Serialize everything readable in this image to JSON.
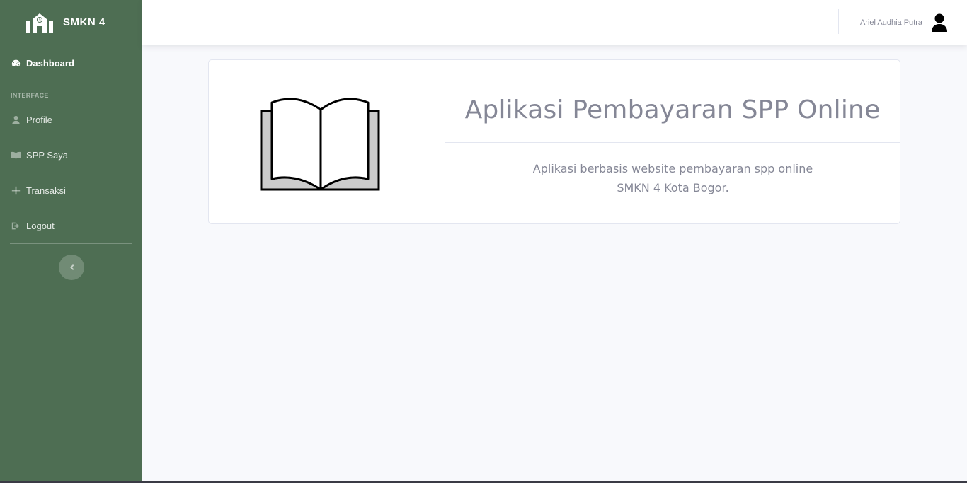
{
  "brand": {
    "name": "SMKN 4",
    "icon": "school-icon"
  },
  "sidebar": {
    "dashboard": {
      "label": "Dashboard",
      "icon": "tachometer-icon"
    },
    "heading": "INTERFACE",
    "items": [
      {
        "label": "Profile",
        "icon": "user-icon"
      },
      {
        "label": "SPP Saya",
        "icon": "book-icon"
      },
      {
        "label": "Transaksi",
        "icon": "plus-icon"
      },
      {
        "label": "Logout",
        "icon": "sign-out-icon"
      }
    ],
    "toggle_icon": "chevron-left-icon"
  },
  "topbar": {
    "user_name": "Ariel Audhia Putra",
    "avatar_icon": "user-avatar-icon"
  },
  "main": {
    "title": "Aplikasi Pembayaran SPP Online",
    "description_line1": "Aplikasi berbasis website pembayaran spp online",
    "description_line2": "SMKN 4 Kota Bogor.",
    "illustration": "open-book-icon"
  },
  "colors": {
    "sidebar_bg": "#4e6e53",
    "text_muted": "#858796",
    "page_bg": "#f8f9fc"
  }
}
